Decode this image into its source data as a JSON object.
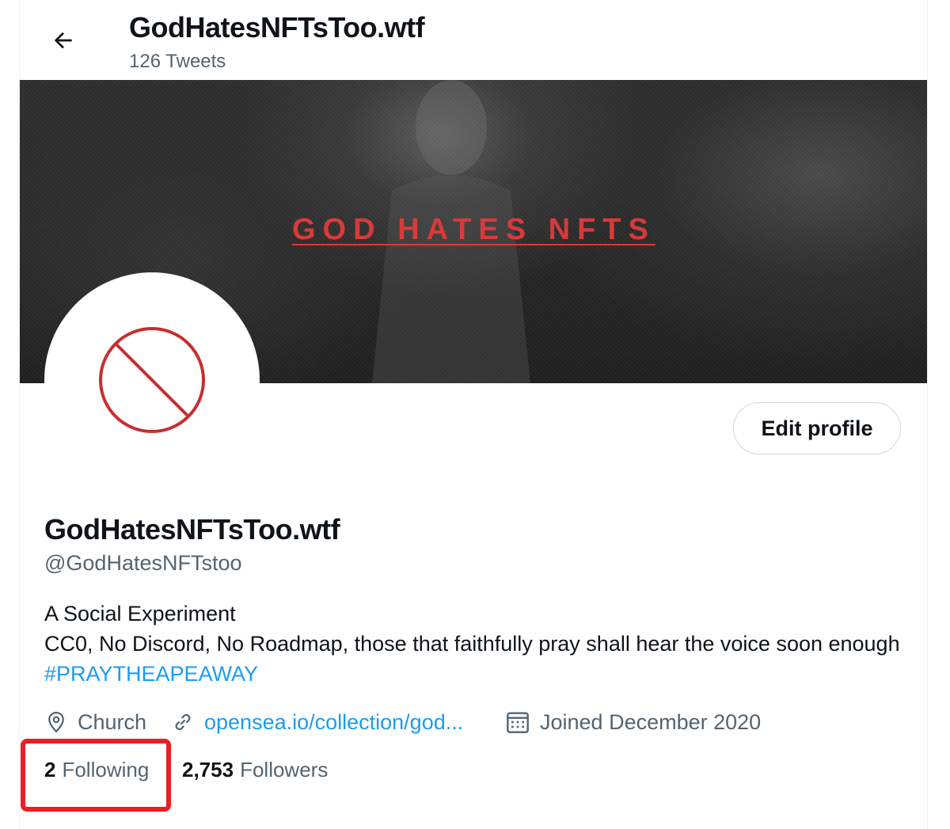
{
  "header": {
    "title": "GodHatesNFTsToo.wtf",
    "tweet_count": "126 Tweets"
  },
  "banner": {
    "text": "GOD HATES NFTS"
  },
  "profile": {
    "display_name": "GodHatesNFTsToo.wtf",
    "handle": "@GodHatesNFTstoo",
    "bio_line1": "A Social Experiment",
    "bio_line2": "CC0, No Discord, No Roadmap, those that faithfully pray shall hear the voice soon enough",
    "bio_hashtag": "#PRAYTHEAPEAWAY",
    "location": "Church",
    "website": "opensea.io/collection/god...",
    "joined": "Joined December 2020",
    "following_count": "2",
    "following_label": "Following",
    "followers_count": "2,753",
    "followers_label": "Followers"
  },
  "actions": {
    "edit_profile": "Edit profile"
  },
  "icons": {
    "back": "arrow-left-icon",
    "avatar": "prohibition-sign-icon",
    "location": "map-pin-icon",
    "link": "link-icon",
    "joined": "calendar-icon"
  },
  "colors": {
    "link": "#1d9bf0",
    "secondary_text": "#536471",
    "banner_text": "#d83a3a",
    "avatar_symbol": "#c62f2f",
    "highlight_box": "#ee1c24"
  }
}
